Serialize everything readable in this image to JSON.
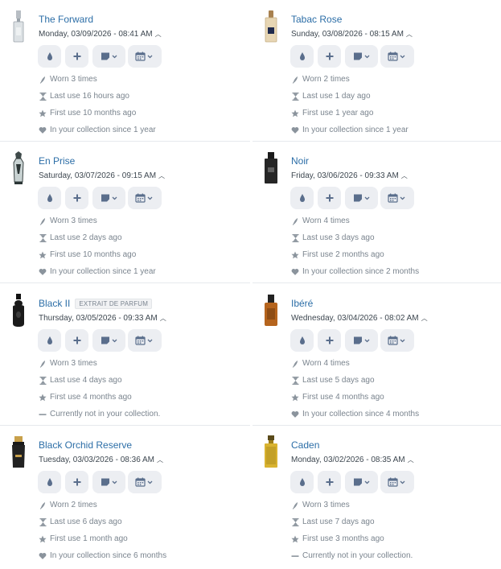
{
  "cards": [
    {
      "name": "The Forward",
      "badge": "",
      "date": "Monday, 03/09/2026 - 08:41 AM",
      "worn": "Worn 3 times",
      "last": "Last use 16 hours ago",
      "first": "First use 10 months ago",
      "collection": "In your collection since 1 year",
      "in_collection": true,
      "bottle": {
        "shape": "tall-clear",
        "cap": "#b8bec4",
        "body": "#dde2e5",
        "accent": "#9aa3aa"
      }
    },
    {
      "name": "Tabac Rose",
      "badge": "",
      "date": "Sunday, 03/08/2026 - 08:15 AM",
      "worn": "Worn 2 times",
      "last": "Last use 1 day ago",
      "first": "First use 1 year ago",
      "collection": "In your collection since 1 year",
      "in_collection": true,
      "bottle": {
        "shape": "rect",
        "cap": "#a8814f",
        "body": "#e7d6b4",
        "accent": "#1f2a4d"
      }
    },
    {
      "name": "En Prise",
      "badge": "",
      "date": "Saturday, 03/07/2026 - 09:15 AM",
      "worn": "Worn 3 times",
      "last": "Last use 2 days ago",
      "first": "First use 10 months ago",
      "collection": "In your collection since 1 year",
      "in_collection": true,
      "bottle": {
        "shape": "ornate",
        "cap": "#3f4a4a",
        "body": "#c8d2d2",
        "accent": "#2b3535"
      }
    },
    {
      "name": "Noir",
      "badge": "",
      "date": "Friday, 03/06/2026 - 09:33 AM",
      "worn": "Worn 4 times",
      "last": "Last use 3 days ago",
      "first": "First use 2 months ago",
      "collection": "In your collection since 2 months",
      "in_collection": true,
      "bottle": {
        "shape": "dark",
        "cap": "#1b1b1b",
        "body": "#262626",
        "accent": "#777"
      }
    },
    {
      "name": "Black II",
      "badge": "EXTRAIT DE PARFUM",
      "date": "Thursday, 03/05/2026 - 09:33 AM",
      "worn": "Worn 3 times",
      "last": "Last use 4 days ago",
      "first": "First use 4 months ago",
      "collection": "Currently not in your collection.",
      "in_collection": false,
      "bottle": {
        "shape": "round-dark",
        "cap": "#111",
        "body": "#1a1a1a",
        "accent": "#555"
      }
    },
    {
      "name": "Ibéré",
      "badge": "",
      "date": "Wednesday, 03/04/2026 - 08:02 AM",
      "worn": "Worn 4 times",
      "last": "Last use 5 days ago",
      "first": "First use 4 months ago",
      "collection": "In your collection since 4 months",
      "in_collection": true,
      "bottle": {
        "shape": "amber",
        "cap": "#222",
        "body": "#b5641d",
        "accent": "#6e3a0e"
      }
    },
    {
      "name": "Black Orchid Reserve",
      "badge": "",
      "date": "Tuesday, 03/03/2026 - 08:36 AM",
      "worn": "Worn 2 times",
      "last": "Last use 6 days ago",
      "first": "First use 1 month ago",
      "collection": "In your collection since 6 months",
      "in_collection": true,
      "bottle": {
        "shape": "dark-gold",
        "cap": "#1a1a1a",
        "body": "#222",
        "accent": "#c8a04a"
      }
    },
    {
      "name": "Caden",
      "badge": "",
      "date": "Monday, 03/02/2026 - 08:35 AM",
      "worn": "Worn 3 times",
      "last": "Last use 7 days ago",
      "first": "First use 3 months ago",
      "collection": "Currently not in your collection.",
      "in_collection": false,
      "bottle": {
        "shape": "gold",
        "cap": "#5a4a1a",
        "body": "#d9b330",
        "accent": "#9c7d18"
      }
    }
  ],
  "icons": {
    "drop": "drop-icon",
    "plus": "plus-icon",
    "note": "note-icon",
    "calendar": "calendar-icon",
    "worn": "spray-icon",
    "last": "hourglass-icon",
    "first": "star-icon",
    "collection": "heart-icon",
    "not_in": "dash-icon"
  },
  "colors": {
    "link": "#2c6ea7",
    "button_bg": "#eceef2",
    "icon": "#5a6e8c",
    "muted": "#7a848e"
  }
}
